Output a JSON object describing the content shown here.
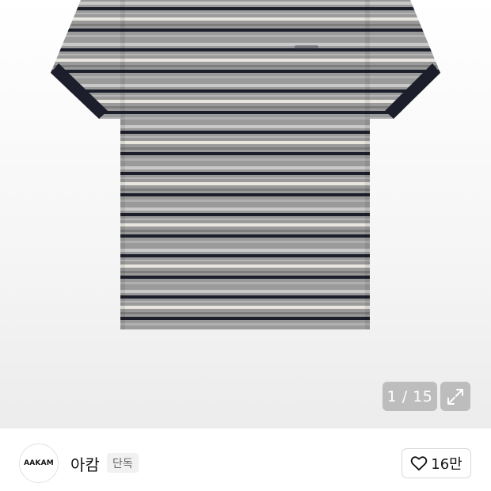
{
  "gallery": {
    "current_index": 1,
    "total": 15,
    "counter_text": "1 / 15",
    "expand_icon": "expand-arrows-icon",
    "image_subject": "gray striped short-sleeve t-shirt"
  },
  "brand": {
    "logo_text": "AAKAM",
    "name": "아캄",
    "badge": "단독"
  },
  "like": {
    "icon": "heart-outline-icon",
    "count": "16만"
  },
  "colors": {
    "shirt_base": "#9a9a9a",
    "stripe_dark": "#1c1f2b",
    "stripe_light": "#e8e6df",
    "overlay": "#969696"
  }
}
